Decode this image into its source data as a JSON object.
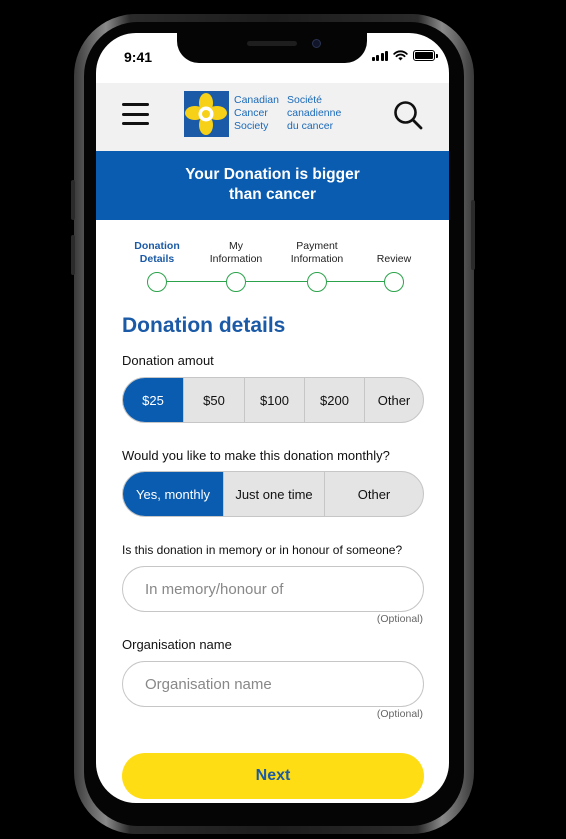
{
  "status_bar": {
    "time": "9:41"
  },
  "header": {
    "logo_en": "Canadian\nCancer\nSociety",
    "logo_fr": "Société\ncanadienne\ndu cancer"
  },
  "banner": {
    "line1": "Your Donation is bigger",
    "line2": "than cancer"
  },
  "steps": [
    {
      "label": "Donation\nDetails",
      "active": true
    },
    {
      "label": "My\nInformation",
      "active": false
    },
    {
      "label": "Payment\nInformation",
      "active": false
    },
    {
      "label": "Review",
      "active": false
    }
  ],
  "form": {
    "title": "Donation details",
    "amount_label": "Donation amout",
    "amount_options": [
      "$25",
      "$50",
      "$100",
      "$200",
      "Other"
    ],
    "amount_selected": "$25",
    "monthly_label": "Would you like to make this donation monthly?",
    "monthly_options": [
      "Yes, monthly",
      "Just one time",
      "Other"
    ],
    "monthly_selected": "Yes, monthly",
    "memory_label": "Is this donation in memory or in honour of someone?",
    "memory_placeholder": "In memory/honour of",
    "memory_optional": "(Optional)",
    "org_label": "Organisation name",
    "org_placeholder": "Organisation name",
    "org_optional": "(Optional)",
    "next_label": "Next"
  },
  "colors": {
    "brand_blue": "#0a5cb0",
    "accent_yellow": "#ffdd15",
    "step_green": "#2aa34a"
  }
}
